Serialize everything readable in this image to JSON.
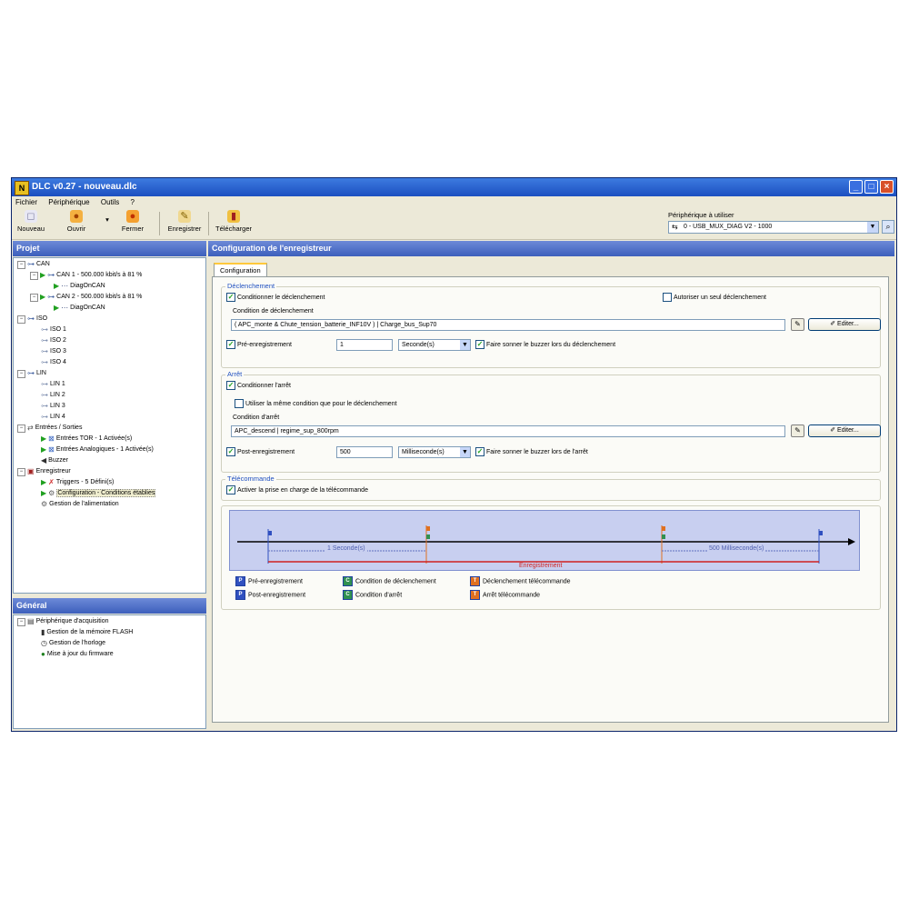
{
  "window": {
    "title": "DLC v0.27 - nouveau.dlc",
    "min": "_",
    "max": "□",
    "close": "×"
  },
  "menu": [
    "Fichier",
    "Périphérique",
    "Outils",
    "?"
  ],
  "toolbar": {
    "nouveau": "Nouveau",
    "ouvrir": "Ouvrir",
    "fermer": "Fermer",
    "enregistrer": "Enregistrer",
    "telecharger": "Télécharger",
    "dropdown_arrow": "▾"
  },
  "device": {
    "label": "Périphérique à utiliser",
    "value": "0 - USB_MUX_DIAG V2 - 1000"
  },
  "project": {
    "header": "Projet",
    "tree": [
      {
        "label": "CAN"
      },
      {
        "label": "CAN 1 - 500.000 kbit/s à 81 %"
      },
      {
        "label": "DiagOnCAN"
      },
      {
        "label": "CAN 2 - 500.000 kbit/s à 81 %"
      },
      {
        "label": "DiagOnCAN"
      },
      {
        "label": "ISO"
      },
      {
        "label": "ISO 1"
      },
      {
        "label": "ISO 2"
      },
      {
        "label": "ISO 3"
      },
      {
        "label": "ISO 4"
      },
      {
        "label": "LIN"
      },
      {
        "label": "LIN 1"
      },
      {
        "label": "LIN 2"
      },
      {
        "label": "LIN 3"
      },
      {
        "label": "LIN 4"
      },
      {
        "label": "Entrées / Sorties"
      },
      {
        "label": "Entrées TOR - 1 Activée(s)"
      },
      {
        "label": "Entrées Analogiques - 1 Activée(s)"
      },
      {
        "label": "Buzzer"
      },
      {
        "label": "Enregistreur"
      },
      {
        "label": "Triggers - 5 Défini(s)"
      },
      {
        "label": "Configuration - Conditions établies"
      },
      {
        "label": "Gestion de l'alimentation"
      }
    ]
  },
  "general": {
    "header": "Général",
    "tree": [
      {
        "label": "Périphérique d'acquisition"
      },
      {
        "label": "Gestion de la mémoire FLASH"
      },
      {
        "label": "Gestion de l'horloge"
      },
      {
        "label": "Mise à jour du firmware"
      }
    ]
  },
  "main": {
    "header": "Configuration de l'enregistreur",
    "tab": "Configuration",
    "declenchement": {
      "title": "Déclenchement",
      "cond_check": "Conditionner le déclenchement",
      "single_check": "Autoriser un seul déclenchement",
      "cond_label": "Condition de déclenchement",
      "cond_value": "( APC_monte & Chute_tension_batterie_INF10V ) | Charge_bus_Sup70",
      "edit": "Editer...",
      "pre_check": "Pré-enregistrement",
      "pre_value": "1",
      "pre_unit": "Seconde(s)",
      "buzzer_check": "Faire sonner le buzzer lors du déclenchement"
    },
    "arret": {
      "title": "Arrêt",
      "cond_check": "Conditionner l'arrêt",
      "same_check": "Utiliser la même condition que pour le déclenchement",
      "cond_label": "Condition d'arrêt",
      "cond_value": "APC_descend | regime_sup_800rpm",
      "edit": "Editer...",
      "post_check": "Post-enregistrement",
      "post_value": "500",
      "post_unit": "Milliseconde(s)",
      "buzzer_check": "Faire sonner le buzzer lors de l'arrêt"
    },
    "telecommande": {
      "title": "Télécommande",
      "check": "Activer la prise en charge de la télécommande"
    },
    "diagram": {
      "pre_span": "1 Seconde(s)",
      "post_span": "500 Milliseconde(s)",
      "record": "Enregistrement"
    },
    "legend": [
      {
        "key": "P",
        "label": "Pré-enregistrement",
        "color": "#3050c0"
      },
      {
        "key": "C",
        "label": "Condition de déclenchement",
        "color": "#309050"
      },
      {
        "key": "T",
        "label": "Déclenchement télécommande",
        "color": "#e07020"
      },
      {
        "key": "P",
        "label": "Post-enregistrement",
        "color": "#3050c0"
      },
      {
        "key": "C",
        "label": "Condition d'arrêt",
        "color": "#309050"
      },
      {
        "key": "T",
        "label": "Arrêt télécommande",
        "color": "#e07020"
      }
    ]
  },
  "colors": {
    "title_bar": "#1c4fc0",
    "panel_header": "#3c5fbc",
    "group_title": "#2050c0",
    "record_line": "#d02020"
  }
}
